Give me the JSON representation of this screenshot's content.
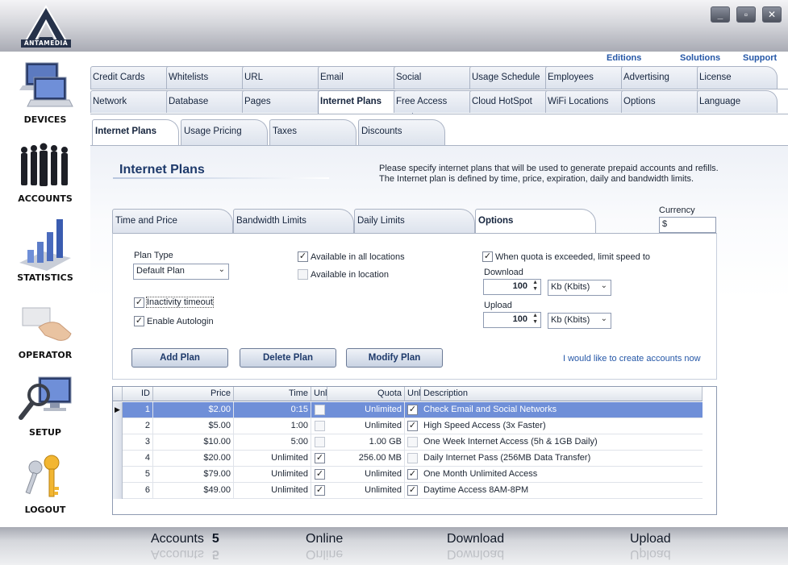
{
  "brand": {
    "logo_text": "ANTAMEDIA"
  },
  "window_buttons": {
    "minimize": "_",
    "maximize": "▫",
    "close": "✕"
  },
  "sidebar": [
    {
      "label": "DEVICES",
      "icon": "laptops-icon"
    },
    {
      "label": "ACCOUNTS",
      "icon": "people-icon"
    },
    {
      "label": "STATISTICS",
      "icon": "bar-chart-icon"
    },
    {
      "label": "OPERATOR",
      "icon": "card-hand-icon"
    },
    {
      "label": "SETUP",
      "icon": "magnifier-monitor-icon"
    },
    {
      "label": "LOGOUT",
      "icon": "keys-icon"
    }
  ],
  "top_links": [
    "Editions",
    "Solutions",
    "Support"
  ],
  "main_tabs_row1": [
    "Credit Cards",
    "Whitelists",
    "URL",
    "Email",
    "Social",
    "Usage Schedule",
    "Employees",
    "Advertising",
    "License"
  ],
  "main_tabs_row2": [
    "Network",
    "Database",
    "Pages",
    "Internet Plans",
    "Free Access",
    "Cloud HotSpot",
    "WiFi Locations",
    "Options",
    "Language"
  ],
  "active_main_tab": "Internet Plans",
  "sub_tabs": [
    "Internet Plans",
    "Usage Pricing",
    "Taxes",
    "Discounts"
  ],
  "page": {
    "heading": "Internet Plans",
    "desc1": "Please specify internet plans that will be used to generate prepaid accounts and refills.",
    "desc2": "The Internet plan is defined by time, price, expiration, daily and bandwidth limits.",
    "currency_label": "Currency",
    "currency_value": "$"
  },
  "inner_tabs": [
    "Time and Price",
    "Bandwidth Limits",
    "Daily Limits",
    "Options"
  ],
  "options": {
    "plan_type_label": "Plan Type",
    "plan_type_value": "Default Plan",
    "inactivity_timeout": "Inactivity timeout",
    "enable_autologin": "Enable Autologin",
    "available_all": "Available in all locations",
    "available_in": "Available in location",
    "quota_limit": "When quota is exceeded, limit speed to",
    "download_label": "Download",
    "download_value": "100",
    "download_unit": "Kb (Kbits)",
    "upload_label": "Upload",
    "upload_value": "100",
    "upload_unit": "Kb (Kbits)"
  },
  "buttons": {
    "add": "Add Plan",
    "delete": "Delete Plan",
    "modify": "Modify Plan"
  },
  "create_link": "I would like to create accounts now",
  "grid": {
    "headers": [
      "ID",
      "Price",
      "Time",
      "Unl",
      "Quota",
      "Unl",
      "Description"
    ],
    "rows": [
      {
        "id": "1",
        "price": "$2.00",
        "time": "0:15",
        "unl_time": false,
        "quota": "Unlimited",
        "unl_quota": true,
        "desc": "Check Email and Social Networks"
      },
      {
        "id": "2",
        "price": "$5.00",
        "time": "1:00",
        "unl_time": false,
        "quota": "Unlimited",
        "unl_quota": true,
        "desc": "High Speed Access (3x Faster)"
      },
      {
        "id": "3",
        "price": "$10.00",
        "time": "5:00",
        "unl_time": false,
        "quota": "1.00 GB",
        "unl_quota": false,
        "desc": "One Week Internet Access (5h & 1GB Daily)"
      },
      {
        "id": "4",
        "price": "$20.00",
        "time": "Unlimited",
        "unl_time": true,
        "quota": "256.00 MB",
        "unl_quota": false,
        "desc": "Daily Internet Pass (256MB Data Transfer)"
      },
      {
        "id": "5",
        "price": "$79.00",
        "time": "Unlimited",
        "unl_time": true,
        "quota": "Unlimited",
        "unl_quota": true,
        "desc": "One Month Unlimited Access"
      },
      {
        "id": "6",
        "price": "$49.00",
        "time": "Unlimited",
        "unl_time": true,
        "quota": "Unlimited",
        "unl_quota": true,
        "desc": "Daytime Access 8AM-8PM"
      }
    ]
  },
  "status": {
    "accounts_label": "Accounts",
    "accounts_value": "5",
    "online_label": "Online",
    "download_label": "Download",
    "upload_label": "Upload"
  }
}
